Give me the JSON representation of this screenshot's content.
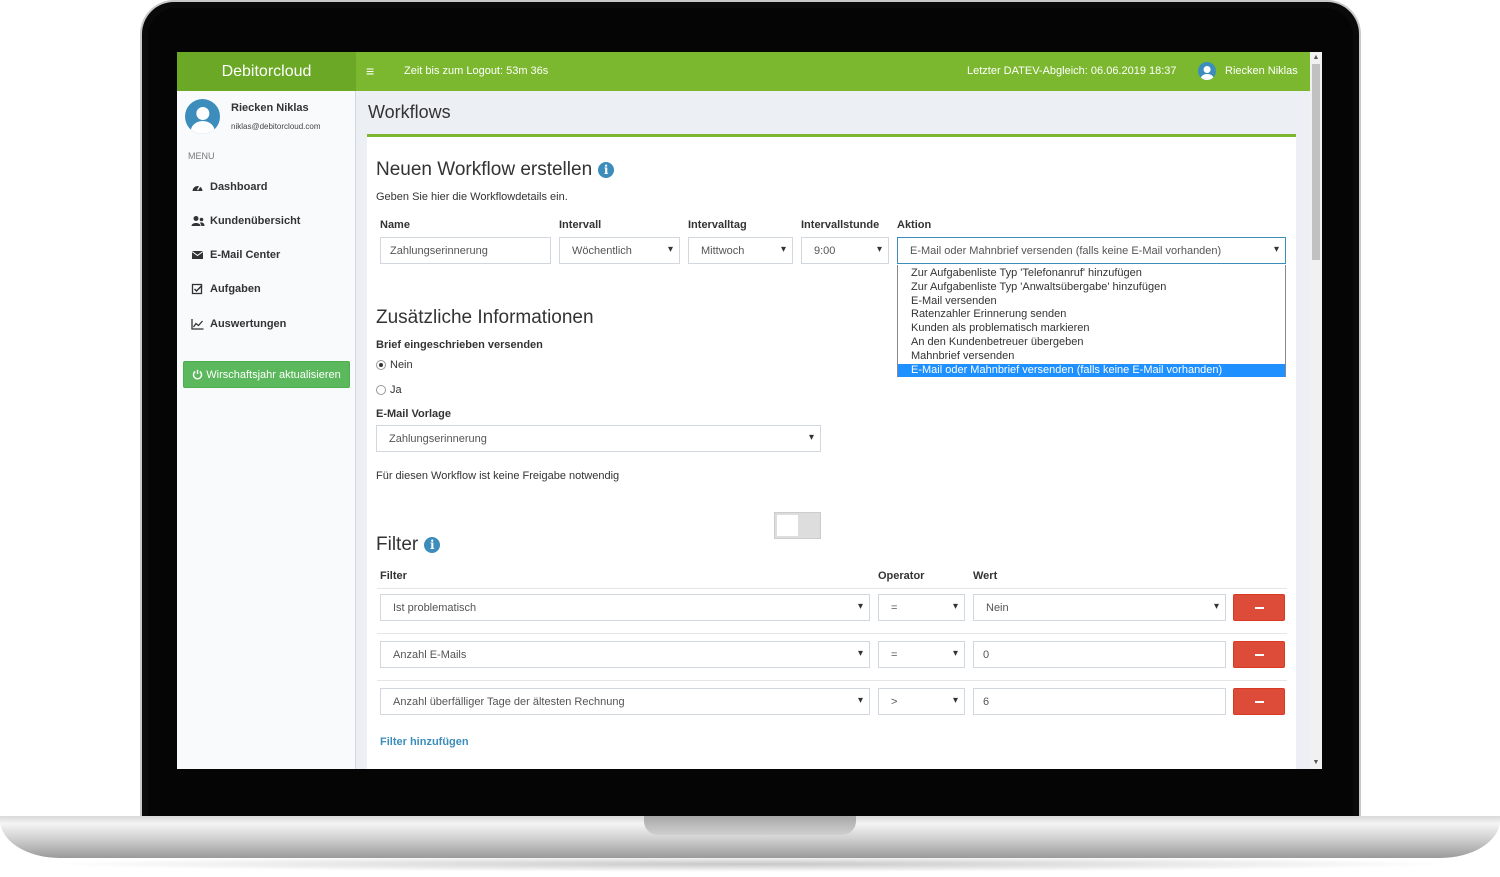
{
  "app": {
    "brand": "Debitorcloud",
    "logout_timer": "Zeit bis zum Logout: 53m 36s",
    "datev_sync": "Letzter DATEV-Abgleich: 06.06.2019 18:37",
    "user_name": "Riecken Niklas",
    "hamburger": "≡"
  },
  "sidebar": {
    "user_name": "Riecken Niklas",
    "user_email": "niklas@debitorcloud.com",
    "menu_header": "MENU",
    "items": [
      {
        "label": "Dashboard",
        "icon": "dashboard-icon"
      },
      {
        "label": "Kundenübersicht",
        "icon": "users-icon"
      },
      {
        "label": "E-Mail Center",
        "icon": "envelope-icon"
      },
      {
        "label": "Aufgaben",
        "icon": "checkbox-icon"
      },
      {
        "label": "Auswertungen",
        "icon": "line-chart-icon"
      }
    ],
    "fiscal_year_button": "Wirschaftsjahr aktualisieren"
  },
  "page": {
    "title": "Workflows"
  },
  "create": {
    "heading": "Neuen Workflow erstellen",
    "info_glyph": "i",
    "subtitle": "Geben Sie hier die Workflowdetails ein.",
    "labels": {
      "name": "Name",
      "interval": "Intervall",
      "interval_day": "Intervalltag",
      "interval_hour": "Intervallstunde",
      "action": "Aktion"
    },
    "values": {
      "name": "Zahlungserinnerung",
      "interval": "Wöchentlich",
      "interval_day": "Mittwoch",
      "interval_hour": "9:00",
      "action": "E-Mail oder Mahnbrief versenden (falls keine E-Mail vorhanden)"
    },
    "action_options": [
      "Zur Aufgabenliste Typ 'Telefonanruf' hinzufügen",
      "Zur Aufgabenliste Typ 'Anwaltsübergabe' hinzufügen",
      "E-Mail versenden",
      "Ratenzahler Erinnerung senden",
      "Kunden als problematisch markieren",
      "An den Kundenbetreuer übergeben",
      "Mahnbrief versenden",
      "E-Mail oder Mahnbrief versenden (falls keine E-Mail vorhanden)"
    ],
    "selected_option_index": 7
  },
  "additional": {
    "heading": "Zusätzliche Informationen",
    "registered_label": "Brief eingeschrieben versenden",
    "radio_no": "Nein",
    "radio_yes": "Ja",
    "registered_value": "Nein",
    "template_label": "E-Mail Vorlage",
    "template_value": "Zahlungserinnerung",
    "approval_text": "Für diesen Workflow ist keine Freigabe notwendig",
    "approval_toggle_on": false
  },
  "filter": {
    "heading": "Filter",
    "info_glyph": "i",
    "col_filter": "Filter",
    "col_operator": "Operator",
    "col_value": "Wert",
    "rows": [
      {
        "filter": "Ist problematisch",
        "operator": "=",
        "value": "Nein"
      },
      {
        "filter": "Anzahl E-Mails",
        "operator": "=",
        "value": "0"
      },
      {
        "filter": "Anzahl überfälliger Tage der ältesten Rechnung",
        "operator": ">",
        "value": "6"
      }
    ],
    "add_link": "Filter hinzufügen"
  },
  "colors": {
    "brand_green": "#7cb82f",
    "brand_green_dark": "#6aa825",
    "accent_blue": "#3c8dbc",
    "danger_red": "#dd4b39",
    "success_green": "#5cb85c",
    "dropdown_highlight": "#1e90ff"
  }
}
